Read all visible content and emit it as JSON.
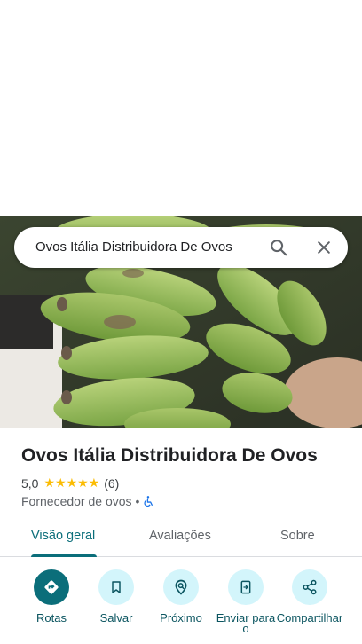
{
  "search": {
    "query": "Ovos Itália Distribuidora De Ovos"
  },
  "place": {
    "name": "Ovos Itália Distribuidora De Ovos",
    "rating": "5,0",
    "stars": "★★★★★",
    "review_count": "(6)",
    "category": "Fornecedor de ovos",
    "separator": "•"
  },
  "tabs": [
    {
      "label": "Visão geral",
      "active": true
    },
    {
      "label": "Avaliações",
      "active": false
    },
    {
      "label": "Sobre",
      "active": false
    }
  ],
  "actions": [
    {
      "label": "Rotas",
      "icon": "directions-icon"
    },
    {
      "label": "Salvar",
      "icon": "bookmark-icon"
    },
    {
      "label": "Próximo",
      "icon": "nearby-icon"
    },
    {
      "label": "Enviar para o",
      "icon": "send-to-phone-icon"
    },
    {
      "label": "Compartilhar",
      "icon": "share-icon"
    }
  ],
  "colors": {
    "accent": "#0b6e7a",
    "action_bg": "#d3f5fb",
    "star": "#fbbc04"
  }
}
